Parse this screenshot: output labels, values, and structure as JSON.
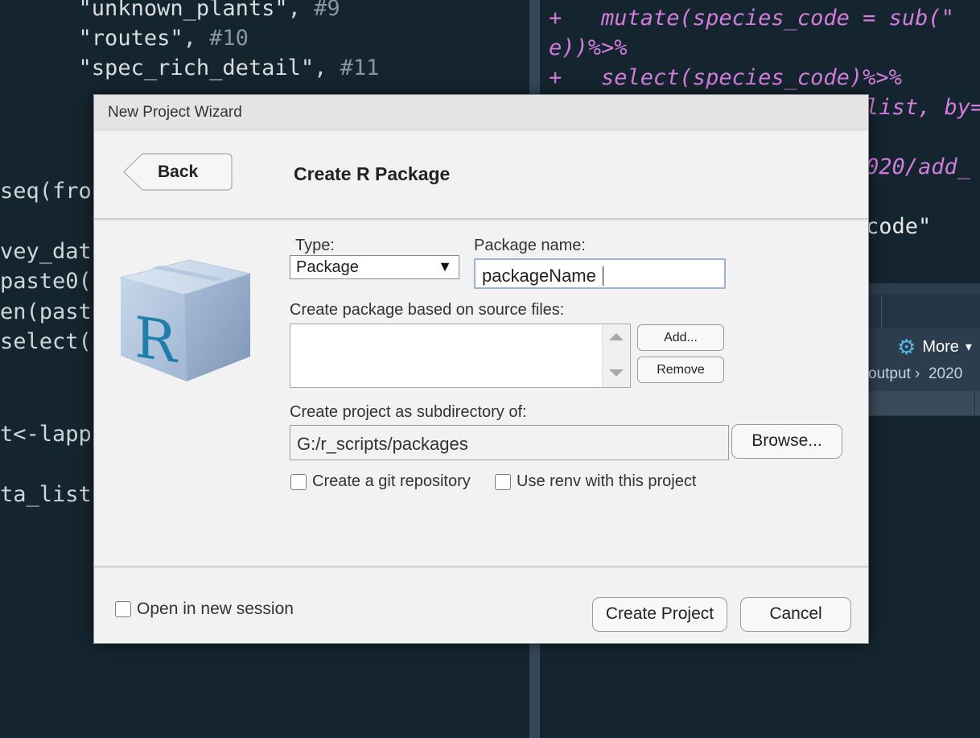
{
  "background": {
    "editor_lines": [
      {
        "pre": "      ",
        "str": "\"unknown_plants\"",
        "post": ", ",
        "cmt": "#9"
      },
      {
        "pre": "      ",
        "str": "\"routes\"",
        "post": ", ",
        "cmt": "#10"
      },
      {
        "pre": "      ",
        "str": "\"spec_rich_detail\"",
        "post": ", ",
        "cmt": "#11"
      },
      {
        "pre": "",
        "a": "seq(fro",
        "b": ""
      },
      {
        "pre": "",
        "a": "vey_dat",
        "b": ""
      },
      {
        "pre": "",
        "a": "paste0(",
        "b": ""
      },
      {
        "pre": "",
        "a": "en(past",
        "b": ""
      },
      {
        "pre": "",
        "a": "select(",
        "b": ""
      },
      {
        "pre": "",
        "a": "t<-lapp",
        "b": ""
      },
      {
        "pre": "",
        "a": "ta_list",
        "b": ""
      }
    ],
    "console_lines": [
      "+   mutate(species_code = sub(\"",
      "e))%>%",
      "+   select(species_code)%>%",
      "list, by=",
      "020/add_",
      "code\""
    ],
    "files_pane": {
      "more_label": "More",
      "more_arrow": "▾",
      "breadcrumb": "output ›  2020"
    }
  },
  "dialog": {
    "title": "New Project Wizard",
    "back_label": "Back",
    "heading": "Create R Package",
    "type_label": "Type:",
    "type_value": "Package",
    "type_arrow": "▼",
    "package_name_label": "Package name:",
    "package_name_value": "packageName",
    "source_files_label": "Create package based on source files:",
    "add_button": "Add...",
    "remove_button": "Remove",
    "subdir_label": "Create project as subdirectory of:",
    "subdir_value": "G:/r_scripts/packages",
    "browse_button": "Browse...",
    "git_checkbox_label": "Create a git repository",
    "renv_checkbox_label": "Use renv with this project",
    "new_session_label": "Open in new session",
    "create_button": "Create Project",
    "cancel_button": "Cancel",
    "logo_letter": "R"
  }
}
